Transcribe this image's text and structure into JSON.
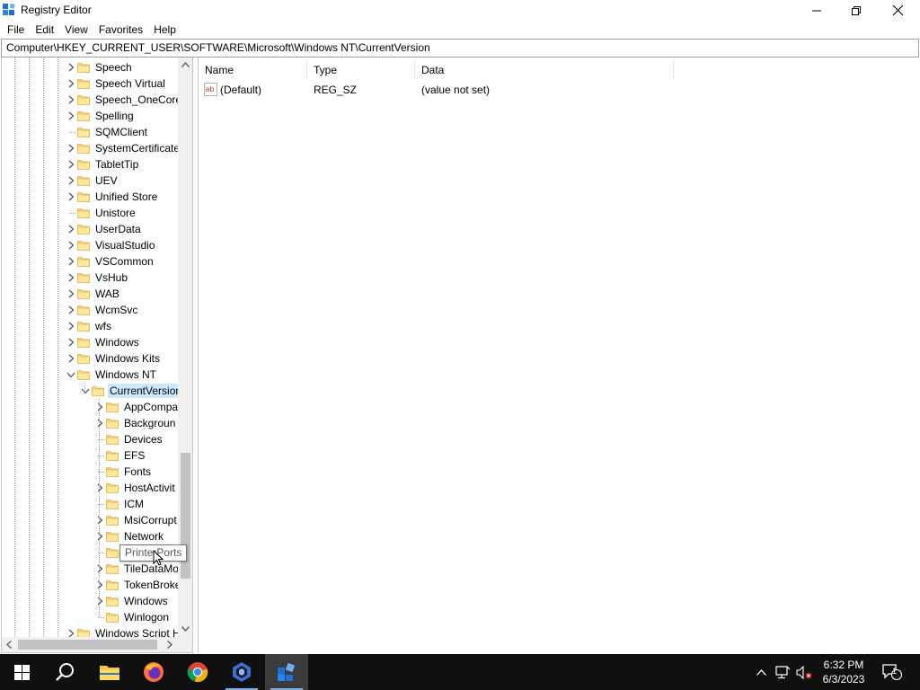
{
  "window": {
    "title": "Registry Editor",
    "controls": {
      "minimize": "minimize",
      "maximize": "restore",
      "close": "close"
    }
  },
  "menu": [
    "File",
    "Edit",
    "View",
    "Favorites",
    "Help"
  ],
  "address": "Computer\\HKEY_CURRENT_USER\\SOFTWARE\\Microsoft\\Windows NT\\CurrentVersion",
  "tree": {
    "items": [
      {
        "label": "Speech",
        "expandable": true
      },
      {
        "label": "Speech Virtual",
        "expandable": true
      },
      {
        "label": "Speech_OneCore",
        "expandable": true
      },
      {
        "label": "Spelling",
        "expandable": true
      },
      {
        "label": "SQMClient",
        "expandable": false
      },
      {
        "label": "SystemCertificate",
        "expandable": true
      },
      {
        "label": "TabletTip",
        "expandable": true
      },
      {
        "label": "UEV",
        "expandable": true
      },
      {
        "label": "Unified Store",
        "expandable": true
      },
      {
        "label": "Unistore",
        "expandable": false
      },
      {
        "label": "UserData",
        "expandable": true
      },
      {
        "label": "VisualStudio",
        "expandable": true
      },
      {
        "label": "VSCommon",
        "expandable": true
      },
      {
        "label": "VsHub",
        "expandable": true
      },
      {
        "label": "WAB",
        "expandable": true
      },
      {
        "label": "WcmSvc",
        "expandable": true
      },
      {
        "label": "wfs",
        "expandable": true
      },
      {
        "label": "Windows",
        "expandable": true
      },
      {
        "label": "Windows Kits",
        "expandable": true
      },
      {
        "label": "Windows NT",
        "expandable": true,
        "expanded": true
      }
    ],
    "selected": {
      "label": "CurrentVersion",
      "expanded": true
    },
    "children": [
      {
        "label": "AppCompa",
        "expandable": true
      },
      {
        "label": "Backgroun",
        "expandable": true
      },
      {
        "label": "Devices",
        "expandable": false
      },
      {
        "label": "EFS",
        "expandable": false
      },
      {
        "label": "Fonts",
        "expandable": false
      },
      {
        "label": "HostActivit",
        "expandable": true
      },
      {
        "label": "ICM",
        "expandable": false
      },
      {
        "label": "MsiCorrupt",
        "expandable": true
      },
      {
        "label": "Network",
        "expandable": true
      },
      {
        "label": "PrinterPorts",
        "expandable": false
      },
      {
        "label": "TileDataMo",
        "expandable": true
      },
      {
        "label": "TokenBroke",
        "expandable": true
      },
      {
        "label": "Windows",
        "expandable": true
      },
      {
        "label": "Winlogon",
        "expandable": false
      }
    ],
    "after": {
      "label": "Windows Script H",
      "expandable": true
    }
  },
  "list": {
    "headers": {
      "name": "Name",
      "type": "Type",
      "data": "Data"
    },
    "rows": [
      {
        "name": "(Default)",
        "type": "REG_SZ",
        "data": "(value not set)",
        "icon": "string-value-icon"
      }
    ]
  },
  "tooltip": "PrinterPorts",
  "taskbar": {
    "apps": [
      "start-icon",
      "search-icon",
      "file-explorer-icon",
      "firefox-icon",
      "chrome-icon",
      "app-icon",
      "registry-editor-icon"
    ],
    "time": "6:32 PM",
    "date": "6/3/2023",
    "notification_count": "1"
  },
  "colors": {
    "selection": "#cce8ff",
    "taskbar": "#101010",
    "folder": "#f5d77a"
  }
}
